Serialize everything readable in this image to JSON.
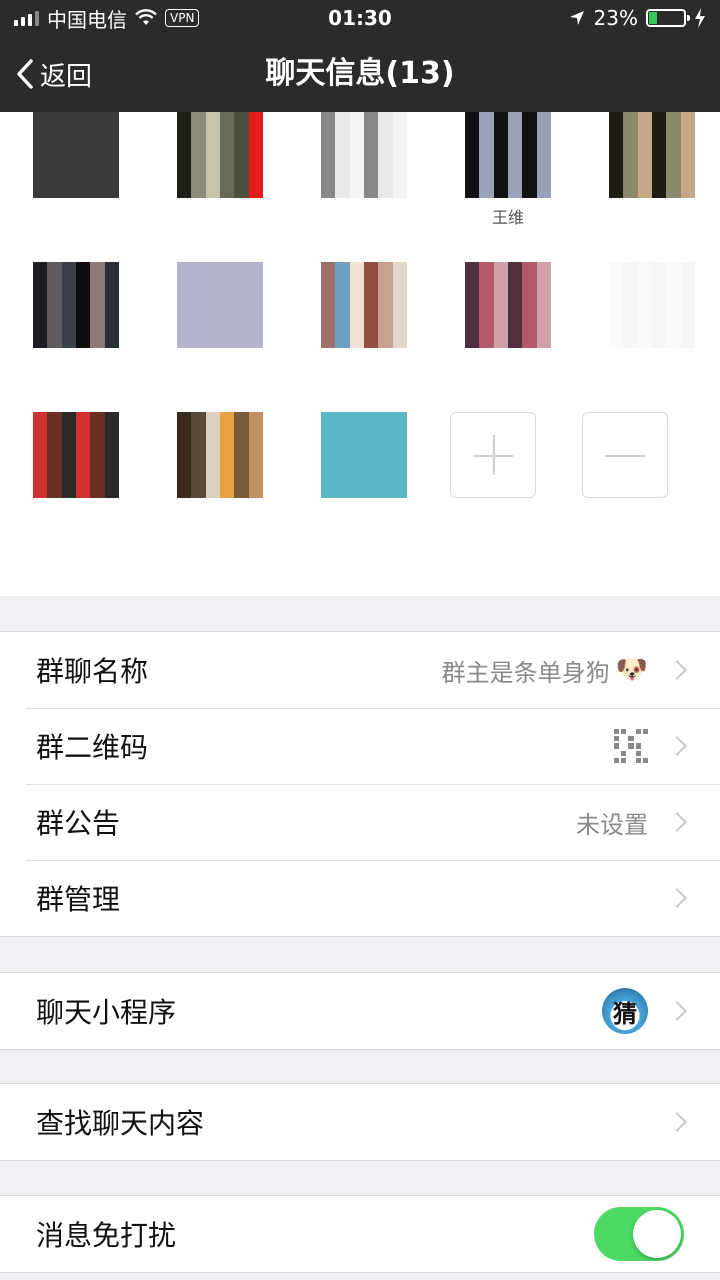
{
  "status_bar": {
    "carrier": "中国电信",
    "vpn_label": "VPN",
    "time": "01:30",
    "battery_percent": "23%",
    "battery_level": 0.23,
    "battery_color": "#34c759"
  },
  "nav": {
    "back_label": "返回",
    "title": "聊天信息(13)"
  },
  "members": [
    {
      "name": "",
      "palette": [
        "#f2f2f2",
        "#3a3a3a",
        "#1e1e1e",
        "#6b5a4e",
        "#8a7a6a",
        "#2a2a2a"
      ]
    },
    {
      "name": "",
      "palette": [
        "#4e4e3e",
        "#e21b1b",
        "#1f1f1a",
        "#8c8c7c",
        "#c8c4a8",
        "#6a6a5a"
      ]
    },
    {
      "name": "",
      "palette": [
        "#ffffff",
        "#f4f4f4",
        "#cfcfcf",
        "#888888",
        "#111111",
        "#e9e9e9"
      ]
    },
    {
      "name": "王维",
      "palette": [
        "#d9d9e4",
        "#9aa0b8",
        "#c9a99a",
        "#3b3b4b",
        "#111111",
        "#b0b0c0"
      ]
    },
    {
      "name": "",
      "palette": [
        "#3b3a2a",
        "#c7a787",
        "#5a5a3a",
        "#8b8b6b",
        "#e1c9a9",
        "#1d1d15"
      ]
    },
    {
      "name": "",
      "palette": [
        "#1c1c22",
        "#2a2e36",
        "#8c7a76",
        "#0e0e12",
        "#3a3f4a",
        "#5e5a5e"
      ]
    },
    {
      "name": "",
      "palette": [
        "#e8e8f0",
        "#b3b3d0",
        "#7a7fa0",
        "#d9c9d9",
        "#5a5f80",
        "#f4f4f8"
      ]
    },
    {
      "name": "",
      "palette": [
        "#c8a090",
        "#e0d8c8",
        "#a0706a",
        "#6fa0c0",
        "#f0e0d0",
        "#905040"
      ]
    },
    {
      "name": "",
      "palette": [
        "#8a4a5a",
        "#d0a0a8",
        "#a06070",
        "#503040",
        "#e8c8c8",
        "#b05a6a"
      ]
    },
    {
      "name": "",
      "palette": [
        "#ffffff",
        "#f6f6f6",
        "#e2e2e2",
        "#c0c0c0",
        "#fafafa",
        "#909090"
      ]
    },
    {
      "name": "",
      "palette": [
        "#b02020",
        "#2a2a2a",
        "#e04030",
        "#6a3020",
        "#111111",
        "#d03030"
      ]
    },
    {
      "name": "",
      "palette": [
        "#3a2a1a",
        "#c09060",
        "#7a5a3a",
        "#e8a040",
        "#dcd0c0",
        "#5a4a3a"
      ]
    },
    {
      "name": "",
      "palette": [
        "#40a8b8",
        "#5ab8c4",
        "#3a98a8",
        "#c08070",
        "#6ac0cc",
        "#2f8898"
      ]
    }
  ],
  "groups": [
    [
      {
        "label": "群聊名称",
        "value": "群主是条单身狗",
        "accessory": "dog-emoji",
        "emoji": "🐶"
      },
      {
        "label": "群二维码",
        "value": "",
        "accessory": "qr-code-icon"
      },
      {
        "label": "群公告",
        "value": "未设置",
        "accessory": "none"
      },
      {
        "label": "群管理",
        "value": "",
        "accessory": "none"
      }
    ],
    [
      {
        "label": "聊天小程序",
        "value": "",
        "accessory": "mini-program-icon",
        "icon_glyph": "猜"
      }
    ],
    [
      {
        "label": "查找聊天内容",
        "value": "",
        "accessory": "none"
      }
    ],
    [
      {
        "label": "消息免打扰",
        "value": "",
        "accessory": "toggle",
        "toggle_on": true,
        "toggle_color": "#4cd964"
      }
    ]
  ]
}
